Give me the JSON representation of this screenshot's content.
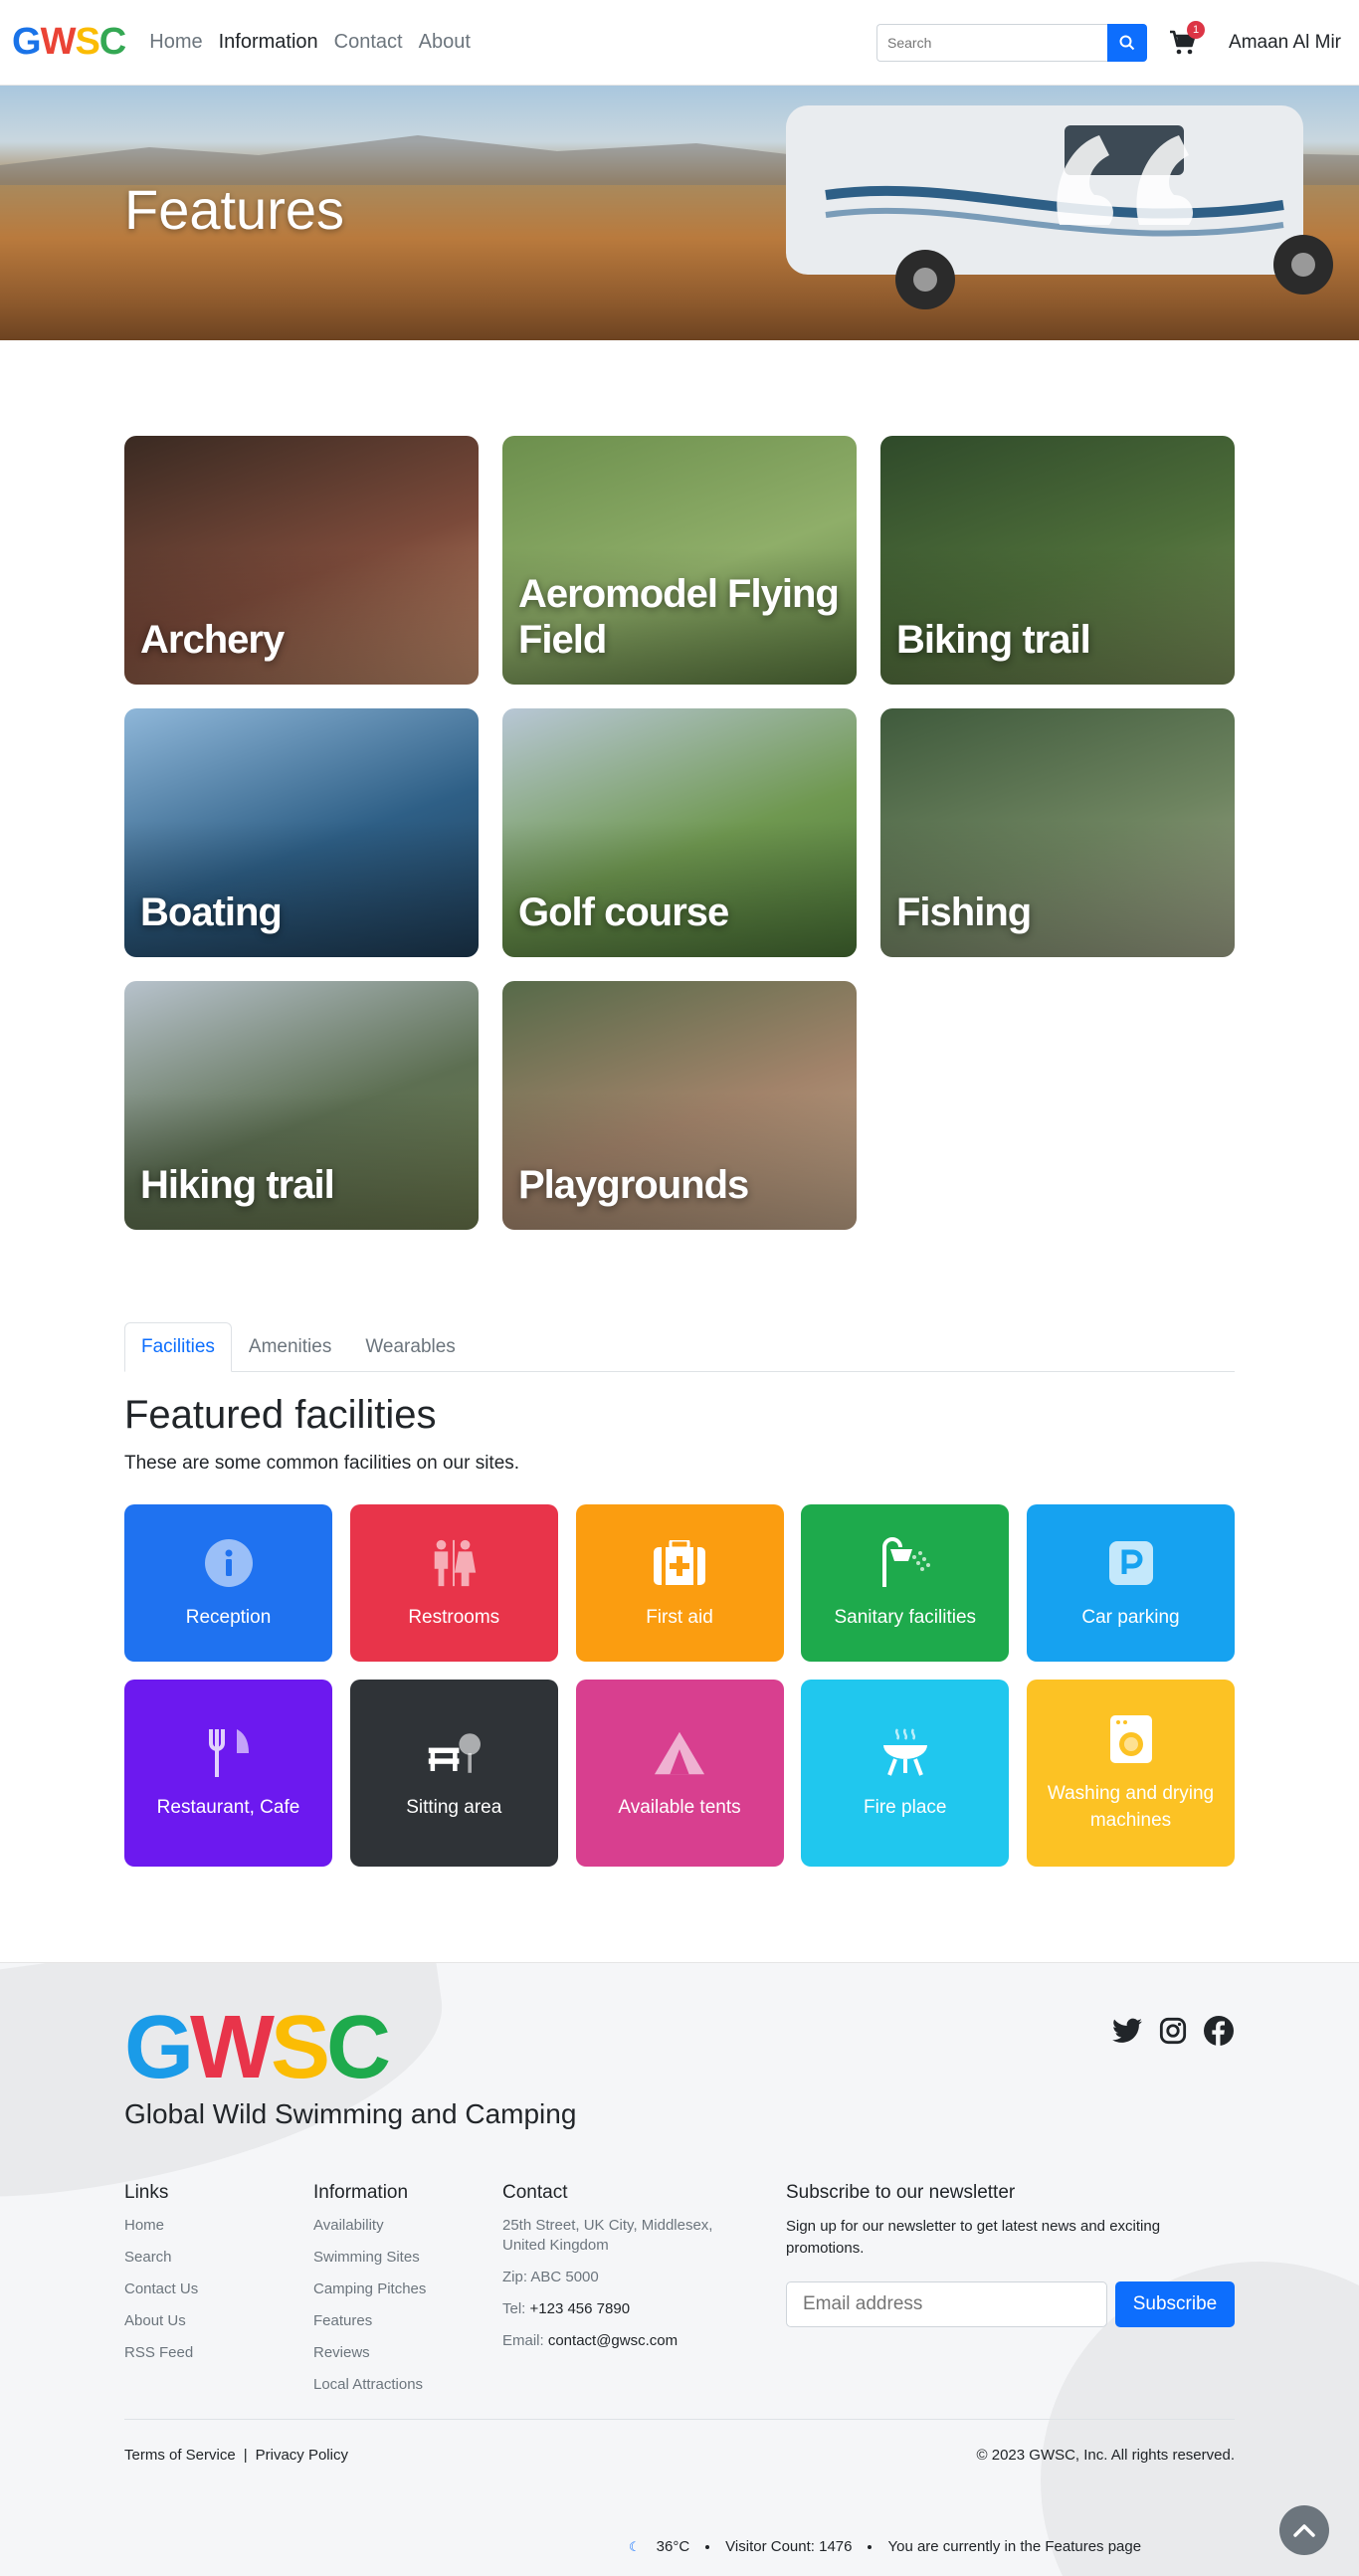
{
  "navbar": {
    "logo_letters": [
      {
        "char": "G",
        "color": "#1a73e8"
      },
      {
        "char": "W",
        "color": "#ea4335"
      },
      {
        "char": "S",
        "color": "#fbbc04"
      },
      {
        "char": "C",
        "color": "#34a853"
      }
    ],
    "links": [
      {
        "label": "Home",
        "active": false
      },
      {
        "label": "Information",
        "active": true
      },
      {
        "label": "Contact",
        "active": false
      },
      {
        "label": "About",
        "active": false
      }
    ],
    "search_placeholder": "Search",
    "search_icon": "search-icon",
    "cart_icon": "cart-icon",
    "cart_count": "1",
    "user_name": "Amaan Al Mir"
  },
  "hero": {
    "title": "Features"
  },
  "features": [
    {
      "label": "Archery",
      "colors": [
        "#3a2a22",
        "#7b4a3a",
        "#c99270"
      ]
    },
    {
      "label": "Aeromodel Flying Field",
      "colors": [
        "#6c8f4d",
        "#8fae69",
        "#5a7a3e"
      ]
    },
    {
      "label": "Biking trail",
      "colors": [
        "#2f4a2a",
        "#4e6e3a",
        "#7b8f5a"
      ]
    },
    {
      "label": "Boating",
      "colors": [
        "#8fb7d9",
        "#2e5f86",
        "#1f3d57"
      ]
    },
    {
      "label": "Golf course",
      "colors": [
        "#b8c7d6",
        "#6f9850",
        "#4a7436"
      ]
    },
    {
      "label": "Fishing",
      "colors": [
        "#3f5a3c",
        "#6e8460",
        "#a3a78c"
      ]
    },
    {
      "label": "Hiking trail",
      "colors": [
        "#b7c2cc",
        "#5d6f52",
        "#6d7a4e"
      ]
    },
    {
      "label": "Playgrounds",
      "colors": [
        "#566a49",
        "#a2836a",
        "#c4a78a"
      ]
    }
  ],
  "tabs": [
    {
      "label": "Facilities",
      "active": true
    },
    {
      "label": "Amenities",
      "active": false
    },
    {
      "label": "Wearables",
      "active": false
    }
  ],
  "facilities_section": {
    "title": "Featured facilities",
    "subtitle": "These are some common facilities on our sites."
  },
  "facilities": [
    {
      "label": "Reception",
      "icon": "info-icon",
      "color": "#1f72f0"
    },
    {
      "label": "Restrooms",
      "icon": "restroom-icon",
      "color": "#e8344a"
    },
    {
      "label": "First aid",
      "icon": "first-aid-icon",
      "color": "#fb9d10"
    },
    {
      "label": "Sanitary facilities",
      "icon": "shower-icon",
      "color": "#1eaa4c"
    },
    {
      "label": "Car parking",
      "icon": "parking-icon",
      "color": "#16a2f0"
    },
    {
      "label": "Restaurant, Cafe",
      "icon": "cutlery-icon",
      "color": "#6c19ef"
    },
    {
      "label": "Sitting area",
      "icon": "bench-icon",
      "color": "#2f3337"
    },
    {
      "label": "Available tents",
      "icon": "tent-icon",
      "color": "#d83f8f"
    },
    {
      "label": "Fire place",
      "icon": "grill-icon",
      "color": "#20c7ee"
    },
    {
      "label": "Washing and drying machines",
      "icon": "washing-machine-icon",
      "color": "#fcc224"
    }
  ],
  "footer": {
    "logo_letters": [
      {
        "char": "G",
        "color": "#1a9be8"
      },
      {
        "char": "W",
        "color": "#e8344a"
      },
      {
        "char": "S",
        "color": "#fbbc04"
      },
      {
        "char": "C",
        "color": "#1eaa4c"
      }
    ],
    "tagline": "Global Wild Swimming and Camping",
    "socials": [
      "twitter-icon",
      "instagram-icon",
      "facebook-icon"
    ],
    "links_title": "Links",
    "links": [
      "Home",
      "Search",
      "Contact Us",
      "About Us",
      "RSS Feed"
    ],
    "info_title": "Information",
    "info_links": [
      "Availability",
      "Swimming Sites",
      "Camping Pitches",
      "Features",
      "Reviews",
      "Local Attractions"
    ],
    "contact_title": "Contact",
    "contact_address": "25th Street, UK City, Middlesex, United Kingdom",
    "contact_zip": "Zip: ABC 5000",
    "contact_tel_label": "Tel: ",
    "contact_tel": "+123 456 7890",
    "contact_email_label": "Email: ",
    "contact_email": "contact@gwsc.com",
    "newsletter_title": "Subscribe to our newsletter",
    "newsletter_text": "Sign up for our newsletter to get latest news and exciting promotions.",
    "email_placeholder": "Email address",
    "subscribe_label": "Subscribe",
    "terms": "Terms of Service",
    "separator": "|",
    "privacy": "Privacy Policy",
    "copyright": "© 2023 GWSC, Inc. All rights reserved.",
    "weather_icon": "moon-icon",
    "temperature": "36°C",
    "visitor_count": "Visitor Count: 1476",
    "current_page": "You are currently in the Features page"
  }
}
